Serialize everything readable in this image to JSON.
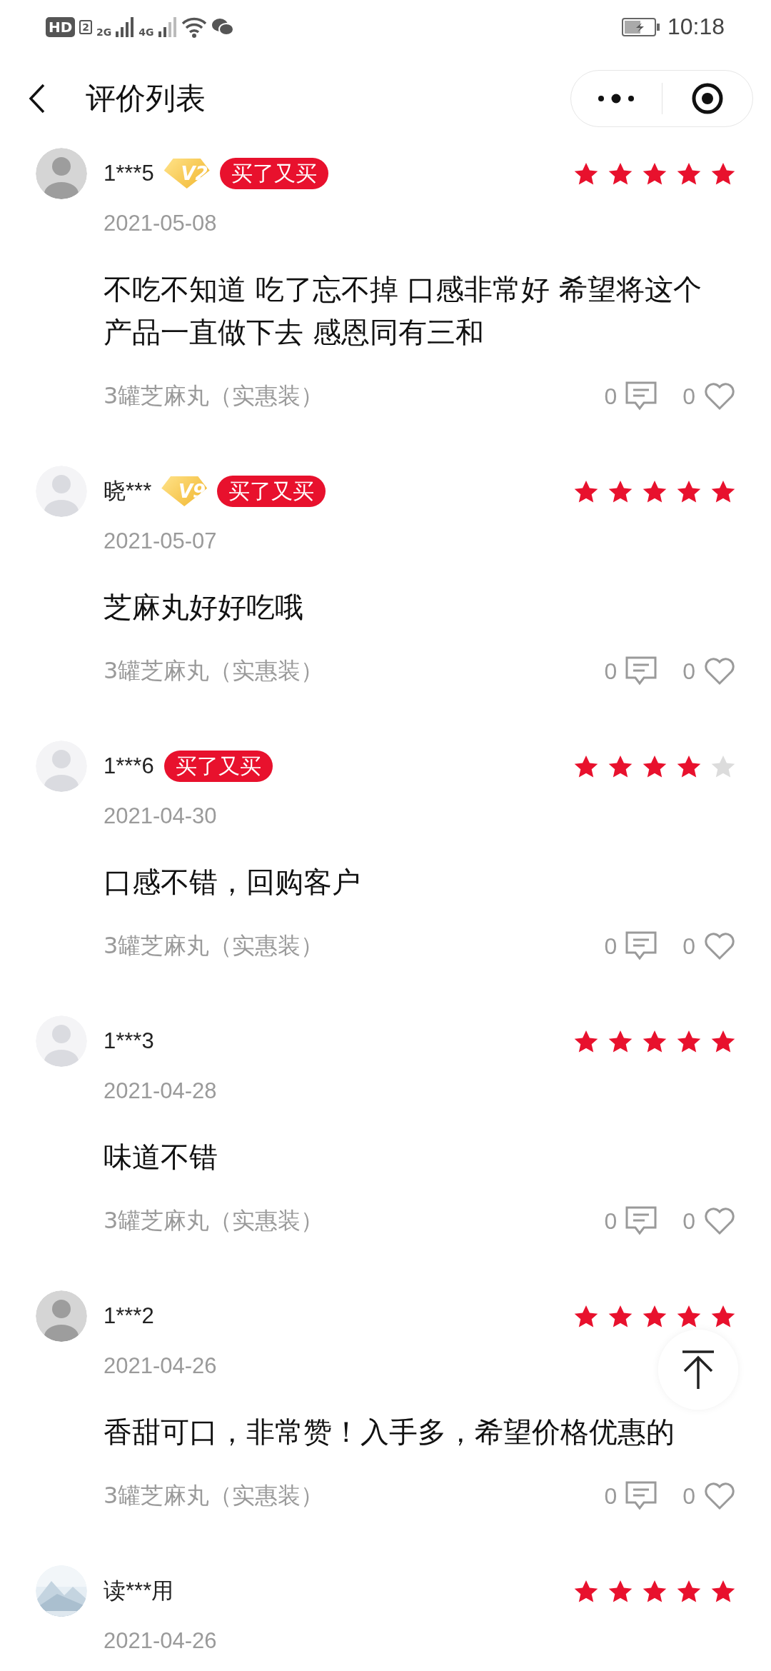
{
  "status_bar": {
    "hd": "HD",
    "hd_sim": "2",
    "sim1": "2G",
    "sim2": "4G",
    "time": "10:18"
  },
  "nav": {
    "title": "评价列表"
  },
  "reviews": [
    {
      "user": "1***5",
      "avatar": {
        "kind": "gray"
      },
      "level": "V2",
      "tag": "买了又买",
      "stars": 5,
      "date": "2021-05-08",
      "text": "不吃不知道 吃了忘不掉 口感非常好 希望将这个产品一直做下去 感恩同有三和",
      "product": "3罐芝麻丸（实惠装）",
      "comments": "0",
      "likes": "0"
    },
    {
      "user": "晓***",
      "avatar": {
        "kind": "faded"
      },
      "level": "V9",
      "tag": "买了又买",
      "stars": 5,
      "date": "2021-05-07",
      "text": "芝麻丸好好吃哦",
      "product": "3罐芝麻丸（实惠装）",
      "comments": "0",
      "likes": "0"
    },
    {
      "user": "1***6",
      "avatar": {
        "kind": "faded"
      },
      "tag": "买了又买",
      "stars": 4,
      "date": "2021-04-30",
      "text": "口感不错，回购客户",
      "product": "3罐芝麻丸（实惠装）",
      "comments": "0",
      "likes": "0"
    },
    {
      "user": "1***3",
      "avatar": {
        "kind": "faded"
      },
      "stars": 5,
      "date": "2021-04-28",
      "text": "味道不错",
      "product": "3罐芝麻丸（实惠装）",
      "comments": "0",
      "likes": "0"
    },
    {
      "user": "1***2",
      "avatar": {
        "kind": "gray"
      },
      "stars": 5,
      "date": "2021-04-26",
      "text": "香甜可口，非常赞！入手多，希望价格优惠的",
      "product": "3罐芝麻丸（实惠装）",
      "comments": "0",
      "likes": "0"
    },
    {
      "user": "读***用",
      "stars": 5,
      "date": "2021-04-26"
    }
  ]
}
